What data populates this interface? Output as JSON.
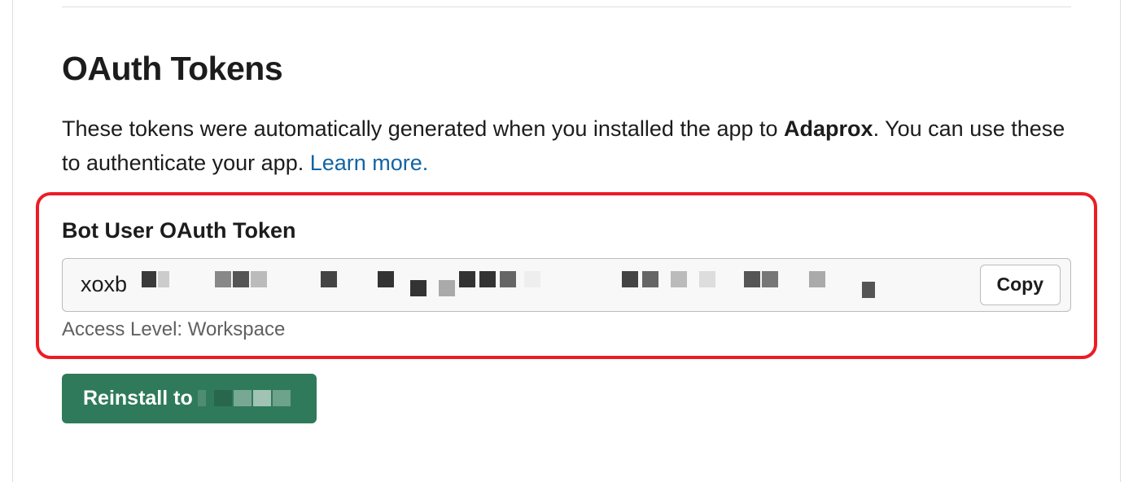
{
  "section": {
    "title": "OAuth Tokens",
    "description_before": "These tokens were automatically generated when you installed the app to ",
    "workspace_name": "Adaprox",
    "description_after": ". You can use these to authenticate your app. ",
    "learn_more": "Learn more."
  },
  "token": {
    "label": "Bot User OAuth Token",
    "value_prefix": "xoxb",
    "copy_label": "Copy",
    "access_level": "Access Level: Workspace"
  },
  "reinstall": {
    "label_prefix": "Reinstall to"
  }
}
